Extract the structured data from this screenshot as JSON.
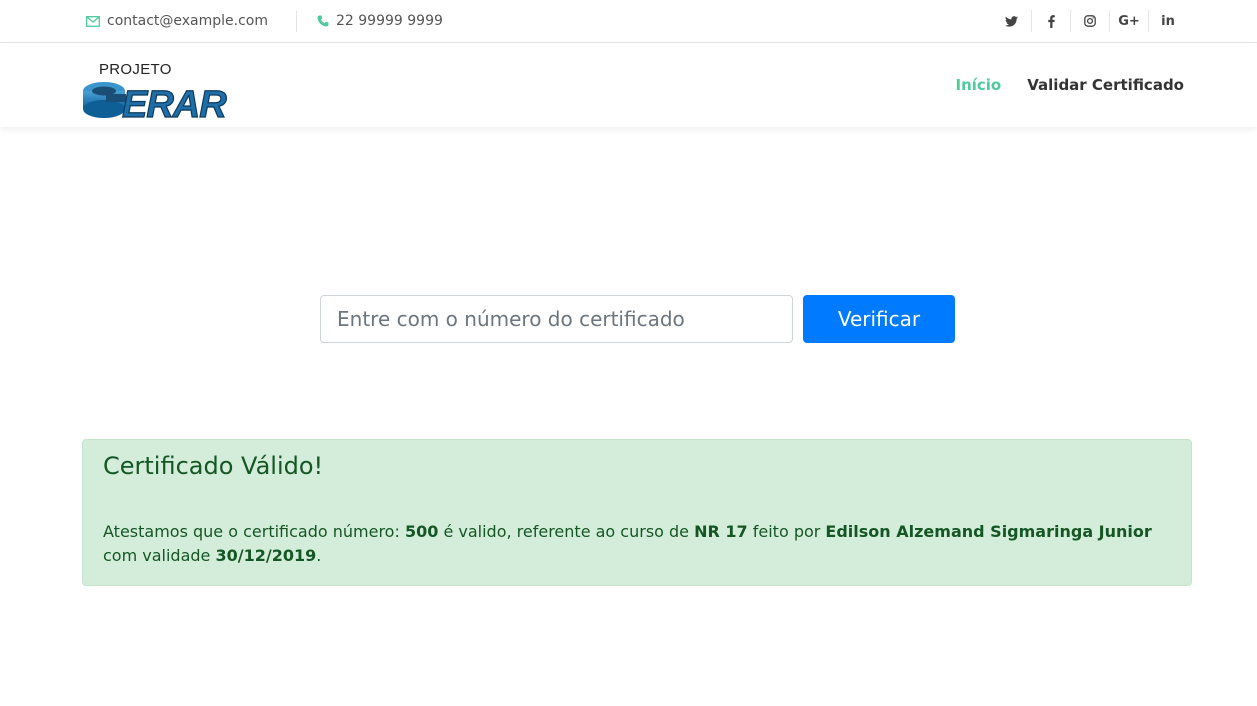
{
  "topbar": {
    "email": "contact@example.com",
    "phone": "22 99999 9999",
    "social": [
      {
        "icon": "twitter-icon",
        "glyph": "🐦"
      },
      {
        "icon": "facebook-icon",
        "glyph": "f"
      },
      {
        "icon": "instagram-icon",
        "glyph": "◎"
      },
      {
        "icon": "google-plus-icon",
        "glyph": "G+"
      },
      {
        "icon": "linkedin-icon",
        "glyph": "in"
      }
    ]
  },
  "brand": {
    "projeto": "PROJETO",
    "name": "GERAR"
  },
  "nav": {
    "home": "Início",
    "validate": "Validar Certificado"
  },
  "search": {
    "placeholder": "Entre com o número do certificado",
    "value": "",
    "button": "Verificar"
  },
  "result": {
    "title": "Certificado Válido!",
    "text_1": "Atestamos que o certificado número: ",
    "number": "500",
    "text_2": " é valido, referente ao curso de ",
    "course": "NR 17",
    "text_3": " feito por ",
    "person": "Edilson Alzemand Sigmaringa Junior",
    "text_4": " com validade ",
    "validity": "30/12/2019",
    "text_5": "."
  },
  "colors": {
    "accent": "#4ecb9b",
    "primary": "#007bff",
    "success_bg": "#d4edda",
    "success_text": "#155724"
  }
}
